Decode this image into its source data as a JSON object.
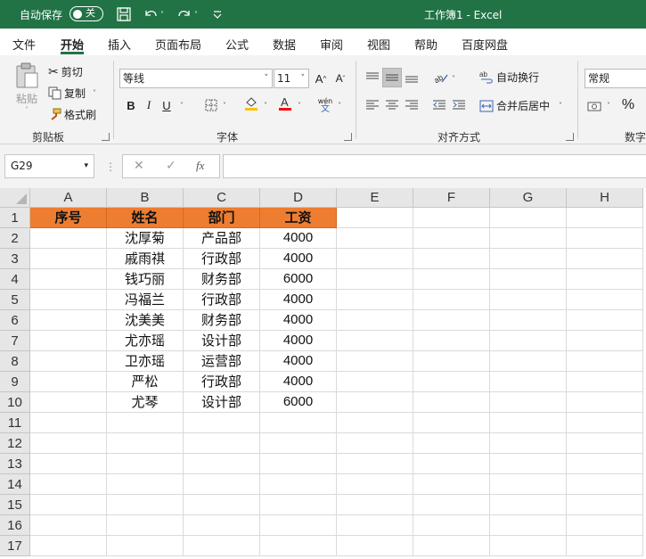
{
  "titlebar": {
    "autosave_label": "自动保存",
    "autosave_state": "关",
    "document_title": "工作簿1  -  Excel"
  },
  "tabs": [
    "文件",
    "开始",
    "插入",
    "页面布局",
    "公式",
    "数据",
    "审阅",
    "视图",
    "帮助",
    "百度网盘"
  ],
  "active_tab": "开始",
  "ribbon": {
    "clipboard": {
      "paste": "粘贴",
      "cut": "剪切",
      "copy": "复制",
      "format_painter": "格式刷",
      "group_label": "剪贴板"
    },
    "font": {
      "font_name": "等线",
      "font_size": "11",
      "bold": "B",
      "italic": "I",
      "underline": "U",
      "phonetic": "wén",
      "group_label": "字体"
    },
    "alignment": {
      "wrap_text": "自动换行",
      "merge_center": "合并后居中",
      "group_label": "对齐方式"
    },
    "number": {
      "format": "常规",
      "percent": "%",
      "group_label": "数字"
    }
  },
  "formula_bar": {
    "name_box": "G29",
    "fx": "fx",
    "formula": ""
  },
  "sheet": {
    "columns": [
      "A",
      "B",
      "C",
      "D",
      "E",
      "F",
      "G",
      "H"
    ],
    "rows": [
      "1",
      "2",
      "3",
      "4",
      "5",
      "6",
      "7",
      "8",
      "9",
      "10",
      "11",
      "12",
      "13",
      "14",
      "15",
      "16",
      "17"
    ],
    "header_row": [
      "序号",
      "姓名",
      "部门",
      "工资"
    ],
    "data": [
      [
        "",
        "沈厚菊",
        "产品部",
        "4000"
      ],
      [
        "",
        "戚雨祺",
        "行政部",
        "4000"
      ],
      [
        "",
        "钱巧丽",
        "财务部",
        "6000"
      ],
      [
        "",
        "冯福兰",
        "行政部",
        "4000"
      ],
      [
        "",
        "沈美美",
        "财务部",
        "4000"
      ],
      [
        "",
        "尤亦瑶",
        "设计部",
        "4000"
      ],
      [
        "",
        "卫亦瑶",
        "运营部",
        "4000"
      ],
      [
        "",
        "严松",
        "行政部",
        "4000"
      ],
      [
        "",
        "尤琴",
        "设计部",
        "6000"
      ]
    ],
    "header_fill": "#ED7D31"
  },
  "colors": {
    "excel_green": "#217346",
    "ribbon_bg": "#F3F3F3",
    "header_fill": "#ED7D31",
    "font_color_bar": "#FF0000",
    "fill_color_bar": "#FFC000"
  }
}
